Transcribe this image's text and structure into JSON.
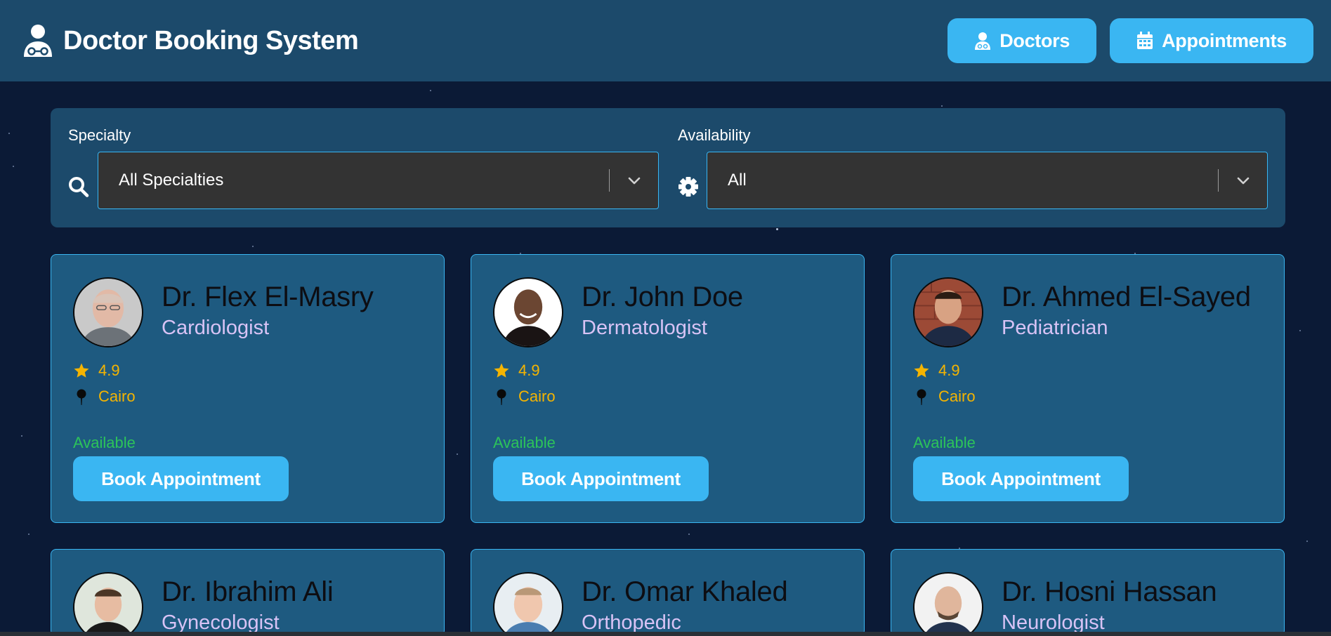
{
  "header": {
    "title": "Doctor Booking System",
    "nav": [
      {
        "label": "Doctors",
        "icon": "doctor-icon"
      },
      {
        "label": "Appointments",
        "icon": "calendar-icon"
      }
    ]
  },
  "filters": {
    "specialty": {
      "label": "Specialty",
      "value": "All Specialties",
      "icon": "search-icon"
    },
    "availability": {
      "label": "Availability",
      "value": "All",
      "icon": "gear-icon"
    }
  },
  "doctors": [
    {
      "name": "Dr. Flex El-Masry",
      "specialty": "Cardiologist",
      "rating": "4.9",
      "location": "Cairo",
      "status": "Available",
      "button": "Book Appointment"
    },
    {
      "name": "Dr. John Doe",
      "specialty": "Dermatologist",
      "rating": "4.9",
      "location": "Cairo",
      "status": "Available",
      "button": "Book Appointment"
    },
    {
      "name": "Dr. Ahmed El-Sayed",
      "specialty": "Pediatrician",
      "rating": "4.9",
      "location": "Cairo",
      "status": "Available",
      "button": "Book Appointment"
    },
    {
      "name": "Dr. Ibrahim Ali",
      "specialty": "Gynecologist"
    },
    {
      "name": "Dr. Omar Khaled",
      "specialty": "Orthopedic"
    },
    {
      "name": "Dr. Hosni Hassan",
      "specialty": "Neurologist"
    }
  ],
  "colors": {
    "accent": "#3ab6f2",
    "panel": "#1c4a6b",
    "card": "#1e5a80",
    "background": "#0b1a36",
    "rating": "#f5b400",
    "available": "#2cc45a",
    "specialty_text": "#d8c3f5"
  }
}
